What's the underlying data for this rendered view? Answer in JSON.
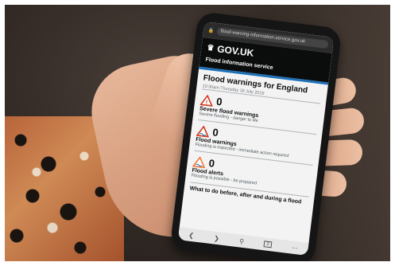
{
  "browser": {
    "url": "flood-warning-information.service.gov.uk"
  },
  "header": {
    "logo_text": "GOV.UK",
    "service_name": "Flood information service"
  },
  "main": {
    "title": "Flood warnings for England",
    "timestamp": "10:30am Thursday 18 July 2019",
    "cards": [
      {
        "count": "0",
        "title": "Severe flood warnings",
        "description": "Severe flooding - danger to life",
        "icon": "severe-warning-icon",
        "color": "#d4351c"
      },
      {
        "count": "0",
        "title": "Flood warnings",
        "description": "Flooding is expected - immediate action required",
        "icon": "flood-warning-icon",
        "color": "#d4351c"
      },
      {
        "count": "0",
        "title": "Flood alerts",
        "description": "Flooding is possible - be prepared",
        "icon": "flood-alert-icon",
        "color": "#f47738"
      }
    ],
    "next_heading": "What to do before, after and during a flood"
  },
  "nav": {
    "back_icon": "chevron-left-icon",
    "forward_icon": "chevron-right-icon",
    "search_icon": "search-icon",
    "tabs_count": "2",
    "menu_icon": "more-icon"
  }
}
